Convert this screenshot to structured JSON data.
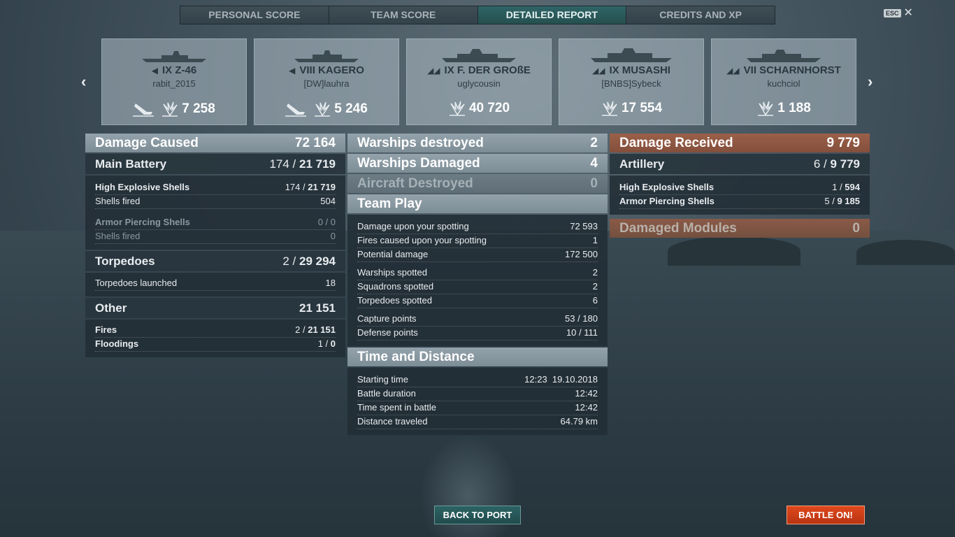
{
  "tabs": [
    {
      "label": "PERSONAL SCORE",
      "active": false
    },
    {
      "label": "TEAM SCORE",
      "active": false
    },
    {
      "label": "DETAILED REPORT",
      "active": true
    },
    {
      "label": "CREDITS AND XP",
      "active": false
    }
  ],
  "esc_label": "ESC",
  "cards": [
    {
      "ship": "IX Z-46",
      "player": "rabit_2015",
      "class_icon": "destroyer-icon",
      "has_kill": true,
      "damage": "7 258"
    },
    {
      "ship": "VIII KAGERO",
      "player": "[DW]lauhra",
      "class_icon": "destroyer-icon",
      "has_kill": true,
      "damage": "5 246"
    },
    {
      "ship": "IX F. DER GROßE",
      "player": "uglycousin",
      "class_icon": "battleship-icon",
      "has_kill": false,
      "damage": "40 720"
    },
    {
      "ship": "IX MUSASHI",
      "player": "[BNBS]Sybeck",
      "class_icon": "battleship-icon",
      "has_kill": false,
      "damage": "17 554"
    },
    {
      "ship": "VII SCHARNHORST",
      "player": "kuchciol",
      "class_icon": "battleship-icon",
      "has_kill": false,
      "damage": "1 188"
    }
  ],
  "left": {
    "damage_caused": {
      "label": "Damage Caused",
      "value": "72 164"
    },
    "main_battery": {
      "label": "Main Battery",
      "hits": "174",
      "dmg": "21 719"
    },
    "he": {
      "label": "High Explosive Shells",
      "hits": "174",
      "dmg": "21 719"
    },
    "he_fired": {
      "label": "Shells fired",
      "value": "504"
    },
    "ap": {
      "label": "Armor Piercing Shells",
      "value": "0 / 0"
    },
    "ap_fired": {
      "label": "Shells fired",
      "value": "0"
    },
    "torpedoes": {
      "label": "Torpedoes",
      "hits": "2",
      "dmg": "29 294"
    },
    "torp_launched": {
      "label": "Torpedoes launched",
      "value": "18"
    },
    "other": {
      "label": "Other",
      "value": "21 151"
    },
    "fires": {
      "label": "Fires",
      "hits": "2",
      "dmg": "21 151"
    },
    "floodings": {
      "label": "Floodings",
      "hits": "1",
      "dmg": "0"
    }
  },
  "middle": {
    "warships_destroyed": {
      "label": "Warships destroyed",
      "value": "2"
    },
    "warships_damaged": {
      "label": "Warships Damaged",
      "value": "4"
    },
    "aircraft_destroyed": {
      "label": "Aircraft Destroyed",
      "value": "0"
    },
    "team_play": {
      "label": "Team Play",
      "rows": [
        {
          "label": "Damage upon your spotting",
          "value": "72 593"
        },
        {
          "label": "Fires caused upon your spotting",
          "value": "1"
        },
        {
          "label": "Potential damage",
          "value": "172 500"
        },
        {
          "label": "Warships spotted",
          "value": "2"
        },
        {
          "label": "Squadrons spotted",
          "value": "2"
        },
        {
          "label": "Torpedoes spotted",
          "value": "6"
        },
        {
          "label": "Capture points",
          "value": "53 / 180"
        },
        {
          "label": "Defense points",
          "value": "10 / 111"
        }
      ]
    },
    "time_distance": {
      "label": "Time and Distance",
      "rows": [
        {
          "label": "Starting time",
          "value": "12:23  19.10.2018"
        },
        {
          "label": "Battle duration",
          "value": "12:42"
        },
        {
          "label": "Time spent in battle",
          "value": "12:42"
        },
        {
          "label": "Distance traveled",
          "value": "64.79 km"
        }
      ]
    }
  },
  "right": {
    "damage_received": {
      "label": "Damage Received",
      "value": "9 779"
    },
    "artillery": {
      "label": "Artillery",
      "hits": "6",
      "dmg": "9 779"
    },
    "he": {
      "label": "High Explosive Shells",
      "hits": "1",
      "dmg": "594"
    },
    "ap": {
      "label": "Armor Piercing Shells",
      "hits": "5",
      "dmg": "9 185"
    },
    "damaged_modules": {
      "label": "Damaged Modules",
      "value": "0"
    }
  },
  "buttons": {
    "back_to_port": "BACK TO PORT",
    "battle_on": "BATTLE ON!"
  }
}
